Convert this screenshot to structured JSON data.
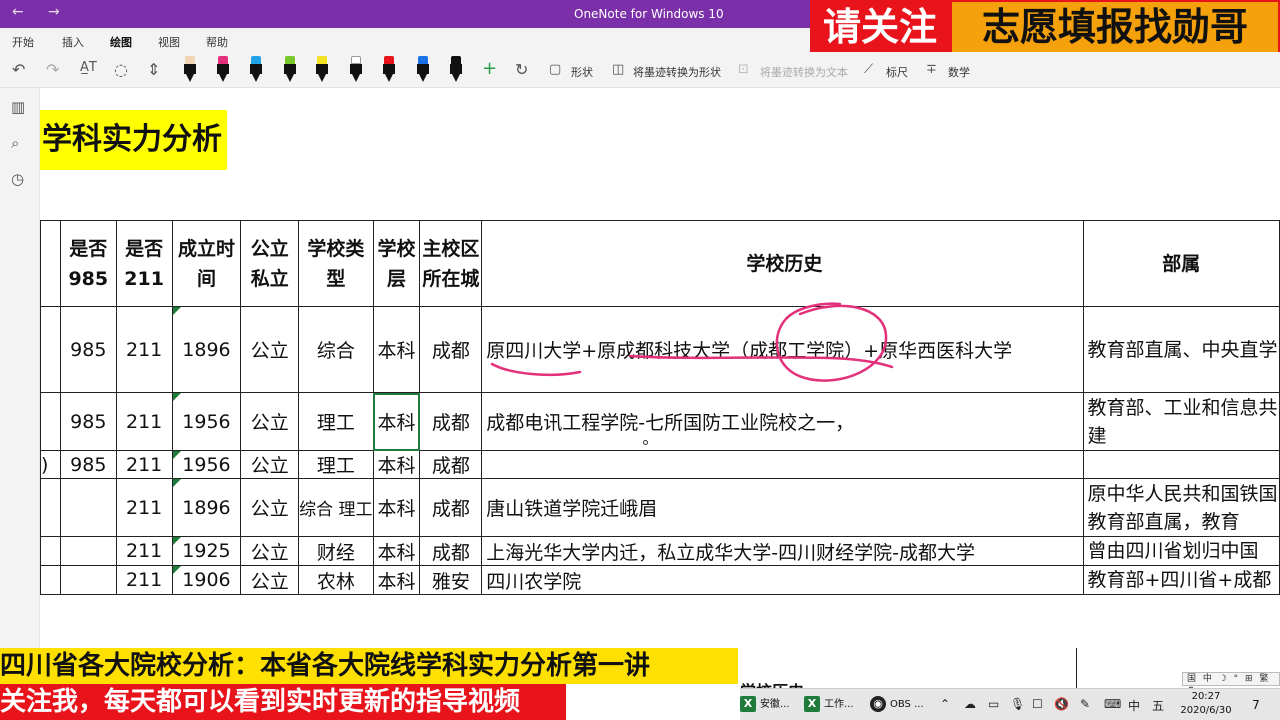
{
  "window": {
    "title": "OneNote for Windows 10",
    "back_icon": "←",
    "forward_icon": "→"
  },
  "ribbon": {
    "tabs": [
      {
        "label": "开始"
      },
      {
        "label": "插入"
      },
      {
        "label": "绘图",
        "active": true
      },
      {
        "label": "视图"
      },
      {
        "label": "帮助"
      }
    ],
    "toolbar": {
      "shape_label": "形状",
      "ink_to_shape_label": "将墨迹转换为形状",
      "ink_to_text_label": "将墨迹转换为文本",
      "ruler_label": "标尺",
      "math_label": "数学"
    },
    "pen_colors": [
      "#f2d6b3",
      "#e2307a",
      "#23a3e8",
      "#79c82c",
      "#f2e11e",
      "#ffffff",
      "#e8131b",
      "#1a73e8",
      "#111111"
    ]
  },
  "promo_top": {
    "left": "请关注",
    "right": "志愿填报找勋哥"
  },
  "page": {
    "heading": "学科实力分析",
    "table": {
      "headers": {
        "is985": "是否985",
        "is211": "是否211",
        "founded": "成立时间",
        "public_private": "公立私立",
        "school_type": "学校类型",
        "level": "学校层",
        "campus_city": "主校区所在城",
        "history": "学校历史",
        "department": "部属"
      },
      "rows": [
        {
          "prefix": "",
          "is985": "985",
          "is211": "211",
          "founded": "1896",
          "public_private": "公立",
          "school_type": "综合",
          "level": "本科",
          "campus_city": "成都",
          "history": "原四川大学+原成都科技大学（成都工学院）+原华西医科大学",
          "department": "教育部直属、中央直学"
        },
        {
          "prefix": "",
          "is985": "985",
          "is211": "211",
          "founded": "1956",
          "public_private": "公立",
          "school_type": "理工",
          "level": "本科",
          "campus_city": "成都",
          "history": "成都电讯工程学院-七所国防工业院校之一，",
          "department": "教育部、工业和信息共建"
        },
        {
          "prefix": ")",
          "is985": "985",
          "is211": "211",
          "founded": "1956",
          "public_private": "公立",
          "school_type": "理工",
          "level": "本科",
          "campus_city": "成都",
          "history": "",
          "department": ""
        },
        {
          "prefix": "",
          "is985": "",
          "is211": "211",
          "founded": "1896",
          "public_private": "公立",
          "school_type": "综合 理工",
          "level": "本科",
          "campus_city": "成都",
          "history": "唐山铁道学院迁峨眉",
          "department": "原中华人民共和国铁国教育部直属，教育"
        },
        {
          "prefix": "",
          "is985": "",
          "is211": "211",
          "founded": "1925",
          "public_private": "公立",
          "school_type": "财经",
          "level": "本科",
          "campus_city": "成都",
          "history": "上海光华大学内迁，私立成华大学-四川财经学院-成都大学",
          "department": "曾由四川省划归中国"
        },
        {
          "prefix": "",
          "is985": "",
          "is211": "211",
          "founded": "1906",
          "public_private": "公立",
          "school_type": "农林",
          "level": "本科",
          "campus_city": "雅安",
          "history": "四川农学院",
          "department": "教育部+四川省+成都"
        }
      ]
    },
    "below_fragment": "学校历史"
  },
  "promo_bottom": {
    "line1": "四川省各大院校分析：本省各大院线学科实力分析第一讲",
    "line2": "关注我，每天都可以看到实时更新的指导视频"
  },
  "taskbar": {
    "apps": [
      {
        "label": "安徽...",
        "badge": "X",
        "color": "#1e7b3c"
      },
      {
        "label": "工作...",
        "badge": "X",
        "color": "#1e7b3c"
      },
      {
        "label": "OBS ...",
        "badge": "◉",
        "color": "#222222"
      }
    ],
    "ime_mode": "中",
    "ime_layout": "五",
    "ime_status": "国 中 ☽ ° ⊞ 繁 ⚙",
    "time": "20:27",
    "date": "2020/6/30",
    "notification_count": "7"
  },
  "colors": {
    "onenote_purple": "#7b2fa8",
    "ink_annotation": "#e2307a",
    "selection_green": "#1e7b3c",
    "heading_highlight": "#ffff00"
  }
}
